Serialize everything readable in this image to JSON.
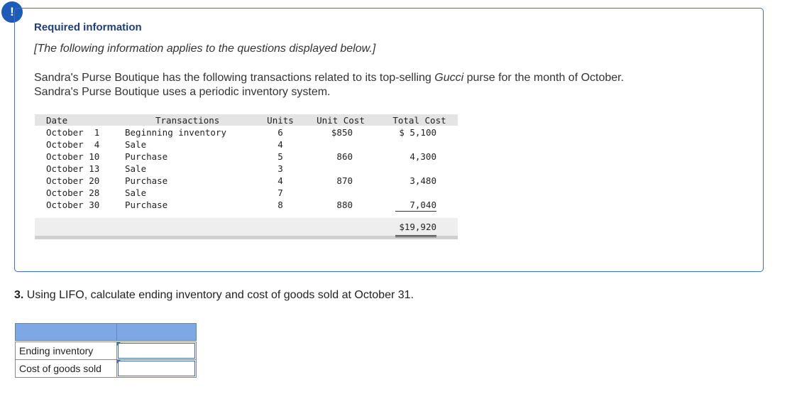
{
  "alert": {
    "icon": "exclamation-icon",
    "symbol": "!"
  },
  "info": {
    "title": "Required information",
    "subtitle": "[The following information applies to the questions displayed below.]",
    "desc_part1": "Sandra's Purse Boutique has the following transactions related to its top-selling ",
    "desc_brand": "Gucci",
    "desc_part2": " purse for the month of October.",
    "desc_line2": "Sandra's Purse Boutique uses a periodic inventory system."
  },
  "table": {
    "headers": {
      "date": "Date",
      "transactions": "Transactions",
      "units": "Units",
      "unit_cost": "Unit Cost",
      "total_cost": "Total Cost"
    },
    "rows": [
      {
        "date": "October  1",
        "transaction": "Beginning inventory",
        "units": "6",
        "unit_cost": "$850",
        "total_cost": "$ 5,100"
      },
      {
        "date": "October  4",
        "transaction": "Sale",
        "units": "4",
        "unit_cost": "",
        "total_cost": ""
      },
      {
        "date": "October 10",
        "transaction": "Purchase",
        "units": "5",
        "unit_cost": "860",
        "total_cost": "4,300"
      },
      {
        "date": "October 13",
        "transaction": "Sale",
        "units": "3",
        "unit_cost": "",
        "total_cost": ""
      },
      {
        "date": "October 20",
        "transaction": "Purchase",
        "units": "4",
        "unit_cost": "870",
        "total_cost": "3,480"
      },
      {
        "date": "October 28",
        "transaction": "Sale",
        "units": "7",
        "unit_cost": "",
        "total_cost": ""
      },
      {
        "date": "October 30",
        "transaction": "Purchase",
        "units": "8",
        "unit_cost": "880",
        "total_cost": "7,040"
      }
    ],
    "grand_total": "$19,920"
  },
  "question": {
    "number": "3.",
    "text": " Using LIFO, calculate ending inventory and cost of goods sold at October 31."
  },
  "answers": {
    "rows": [
      {
        "label": "Ending inventory",
        "value": ""
      },
      {
        "label": "Cost of goods sold",
        "value": ""
      }
    ]
  },
  "colors": {
    "accent": "#1d5bb8",
    "border": "#3a6fc4",
    "header_fill": "#7ea8e4"
  }
}
